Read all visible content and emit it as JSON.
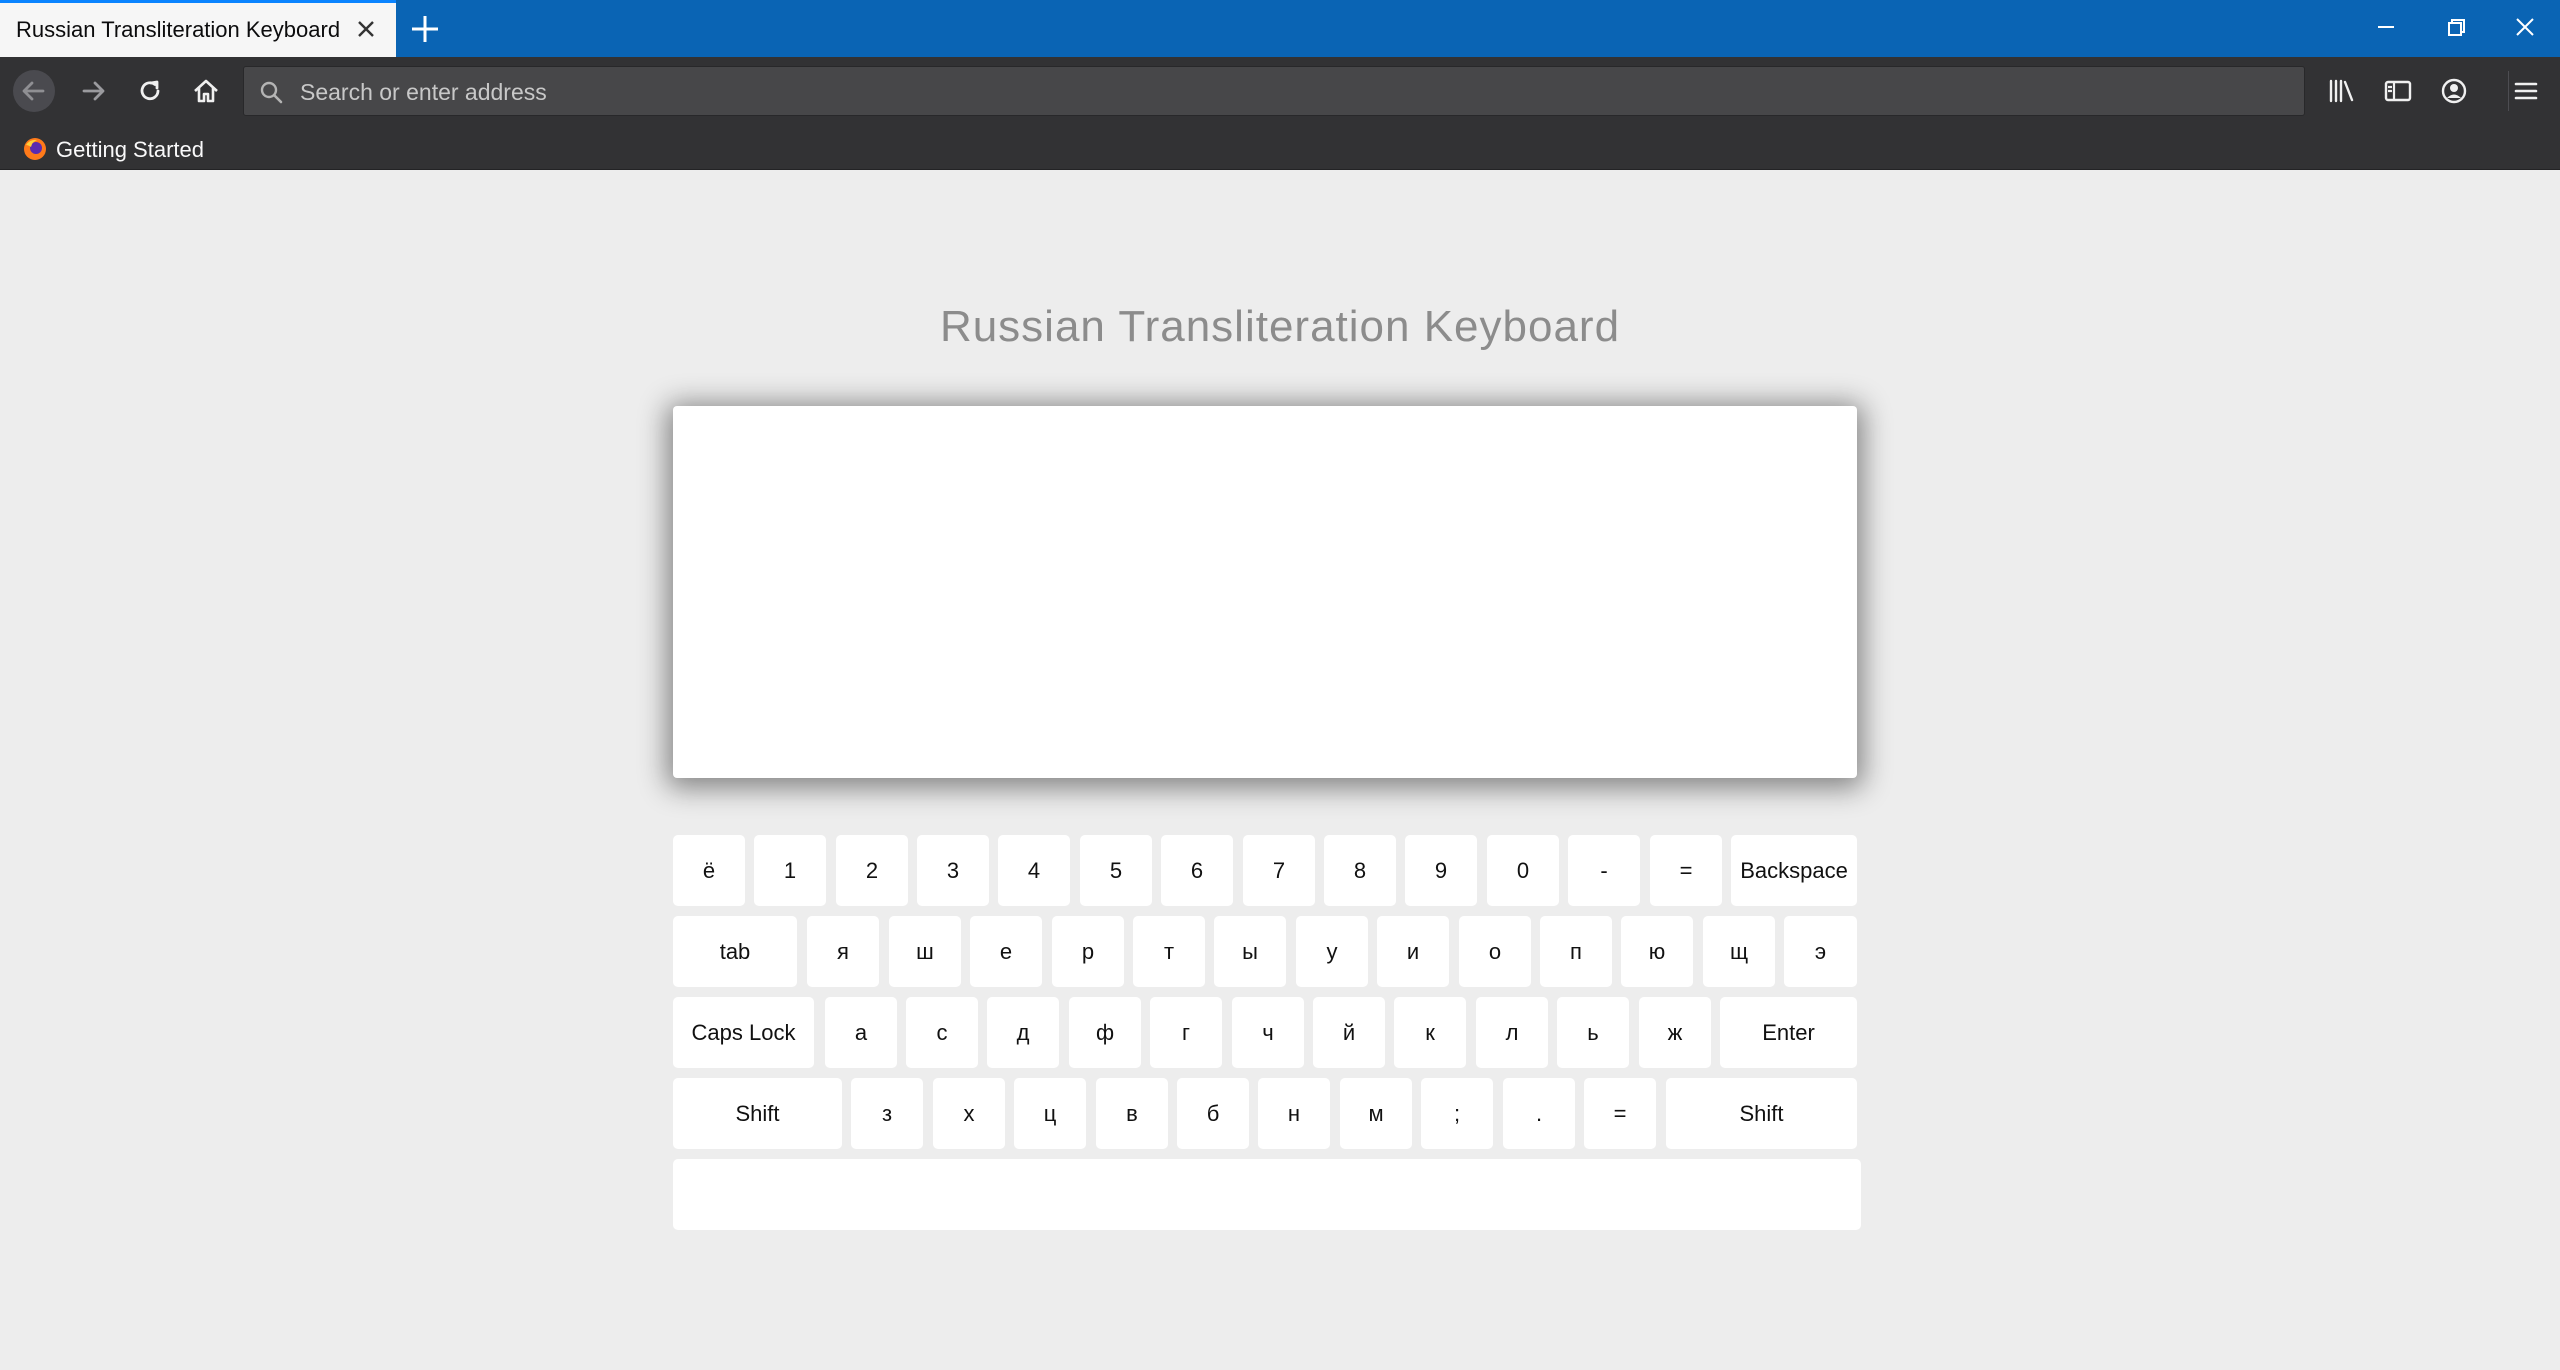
{
  "browser": {
    "tab_title": "Russian Transliteration Keyboard",
    "url_placeholder": "Search or enter address",
    "bookmark_label": "Getting Started",
    "colors": {
      "titlebar": "#0a64b4",
      "toolbar": "#323234",
      "page_bg": "#ededed"
    }
  },
  "page": {
    "title": "Russian Transliteration Keyboard",
    "text_value": ""
  },
  "keyboard": {
    "rows": [
      [
        "ё",
        "1",
        "2",
        "3",
        "4",
        "5",
        "6",
        "7",
        "8",
        "9",
        "0",
        "-",
        "=",
        "Backspace"
      ],
      [
        "tab",
        "я",
        "ш",
        "е",
        "р",
        "т",
        "ы",
        "у",
        "и",
        "о",
        "п",
        "ю",
        "щ",
        "э"
      ],
      [
        "Caps Lock",
        "а",
        "с",
        "д",
        "ф",
        "г",
        "ч",
        "й",
        "к",
        "л",
        "ь",
        "ж",
        "Enter"
      ],
      [
        "Shift",
        "з",
        "х",
        "ц",
        "в",
        "б",
        "н",
        "м",
        ";",
        ".",
        "=",
        "Shift"
      ],
      [
        ""
      ]
    ]
  }
}
